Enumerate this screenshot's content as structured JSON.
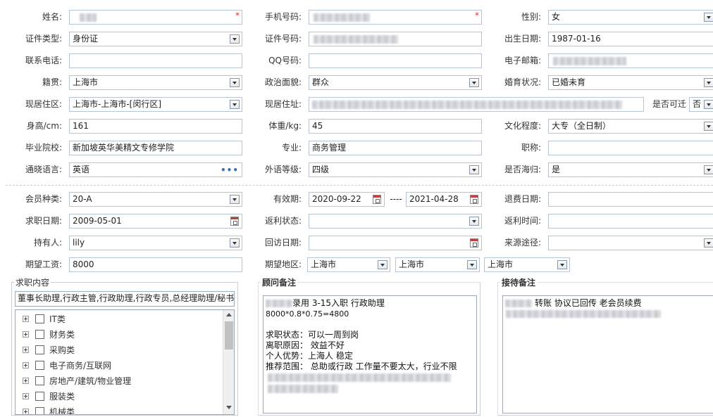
{
  "basic": {
    "name_label": "姓名:",
    "mobile_label": "手机号码:",
    "gender_label": "性别:",
    "gender_value": "女",
    "id_type_label": "证件类型:",
    "id_type_value": "身份证",
    "id_no_label": "证件号码:",
    "birth_label": "出生日期:",
    "birth_value": "1987-01-16",
    "phone_label": "联系电话:",
    "qq_label": "QQ号码:",
    "email_label": "电子邮箱:",
    "origin_label": "籍贯:",
    "origin_value": "上海市",
    "politics_label": "政治面貌:",
    "politics_value": "群众",
    "marital_label": "婚育状况:",
    "marital_value": "已婚未育",
    "district_label": "现居住区:",
    "district_value": "上海市-上海市-[闵行区]",
    "address_label": "现居住址:",
    "relocate_label": "是否可迁",
    "relocate_value": "否",
    "height_label": "身高/cm:",
    "height_value": "161",
    "weight_label": "体重/kg:",
    "weight_value": "45",
    "education_label": "文化程度:",
    "education_value": "大专（全日制）",
    "school_label": "毕业院校:",
    "school_value": "新加坡英华美精文专修学院",
    "major_label": "专业:",
    "major_value": "商务管理",
    "title_label": "职称:",
    "language_label": "通晓语言:",
    "language_value": "英语",
    "language_more": "•••",
    "lang_level_label": "外语等级:",
    "lang_level_value": "四级",
    "returnee_label": "是否海归:",
    "returnee_value": "是"
  },
  "membership": {
    "type_label": "会员种类:",
    "type_value": "20-A",
    "valid_label": "有效期:",
    "valid_from": "2020-09-22",
    "valid_sep": "----",
    "valid_to": "2021-04-28",
    "refund_date_label": "退费日期:",
    "apply_date_label": "求职日期:",
    "apply_date_value": "2009-05-01",
    "rebate_status_label": "返利状态:",
    "rebate_time_label": "返利时间:",
    "holder_label": "持有人:",
    "holder_value": "lily",
    "visit_date_label": "回访日期:",
    "source_label": "来源途径:",
    "salary_label": "期望工资:",
    "salary_value": "8000",
    "region_label": "期望地区:",
    "region_1": "上海市",
    "region_2": "上海市",
    "region_3": "上海市"
  },
  "job_content": {
    "title": "求职内容",
    "selected": "董事长助理,行政主管,行政助理,行政专员,总经理助理/秘书",
    "categories": [
      "IT类",
      "财务类",
      "采购类",
      "电子商务/互联网",
      "房地产/建筑/物业管理",
      "服装类",
      "机械类"
    ]
  },
  "consultant_notes": {
    "title": "顾问备注",
    "line1": "录用  3-15入职 行政助理",
    "line2": "8000*0.8*0.75=4800",
    "line3": "求职状态：可以一周到岗",
    "line4": "离职原因： 效益不好",
    "line5": "个人优势：上海人 稳定",
    "line6": "推荐范围： 总助或行政 工作量不要太大，行业不限"
  },
  "reception_notes": {
    "title": "接待备注",
    "line1": "转账 协议已回传 老会员续费"
  }
}
